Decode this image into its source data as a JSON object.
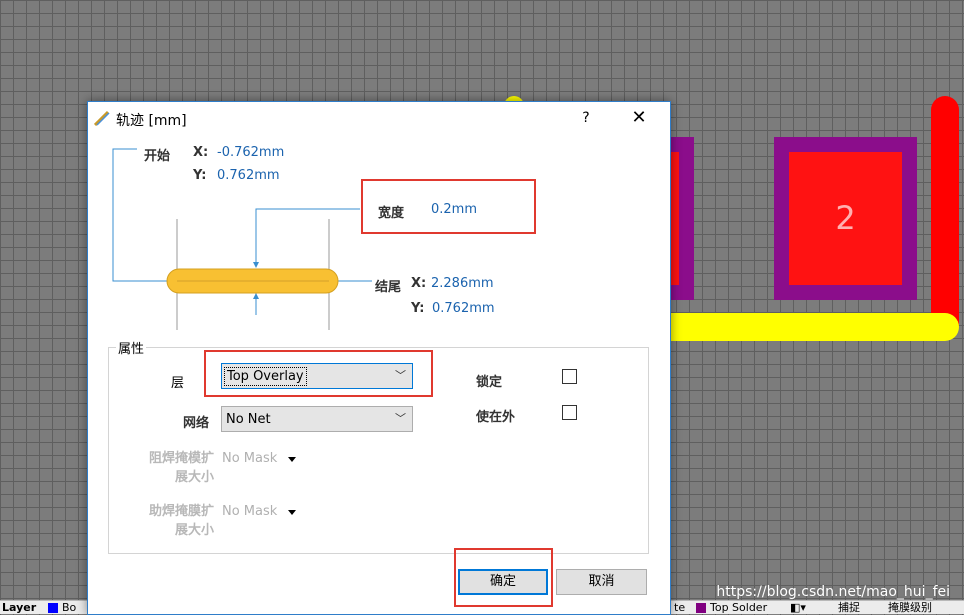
{
  "canvas": {
    "pad_label": "2",
    "colors": {
      "pad_outer": "#8b0d8b",
      "pad_inner": "#ff1212",
      "track_bottom": "#ffff00",
      "track_right": "#ff0000",
      "grid": "#5f5f5f"
    }
  },
  "status_bar": {
    "layer_label": "Layer",
    "layer_item": "Bo",
    "right_item_partial": "te",
    "top_solder": "Top Solder",
    "capture": "捕捉",
    "mask_level": "掩膜级别"
  },
  "watermark": "https://blog.csdn.net/mao_hui_fei",
  "dialog": {
    "title": "轨迹 [mm]",
    "help": "?",
    "close": "✕",
    "start": {
      "label": "开始",
      "x_label": "X:",
      "x": "-0.762mm",
      "y_label": "Y:",
      "y": "0.762mm"
    },
    "width": {
      "label": "宽度",
      "value": "0.2mm"
    },
    "end": {
      "label": "结尾",
      "x_label": "X:",
      "x": "2.286mm",
      "y_label": "Y:",
      "y": "0.762mm"
    },
    "properties": {
      "group_title": "属性",
      "layer": {
        "label": "层",
        "value": "Top Overlay"
      },
      "net": {
        "label": "网络",
        "value": "No Net"
      },
      "locked": {
        "label": "锁定",
        "checked": false
      },
      "keepout": {
        "label": "使在外",
        "checked": false
      },
      "solder_mask": {
        "label_line1": "阻焊掩模扩",
        "label_line2": "展大小",
        "value": "No Mask"
      },
      "paste_mask": {
        "label_line1": "助焊掩膜扩",
        "label_line2": "展大小",
        "value": "No Mask"
      }
    },
    "ok_label": "确定",
    "cancel_label": "取消",
    "highlight_color": "#e0392f",
    "track_color": "#f8c032"
  }
}
